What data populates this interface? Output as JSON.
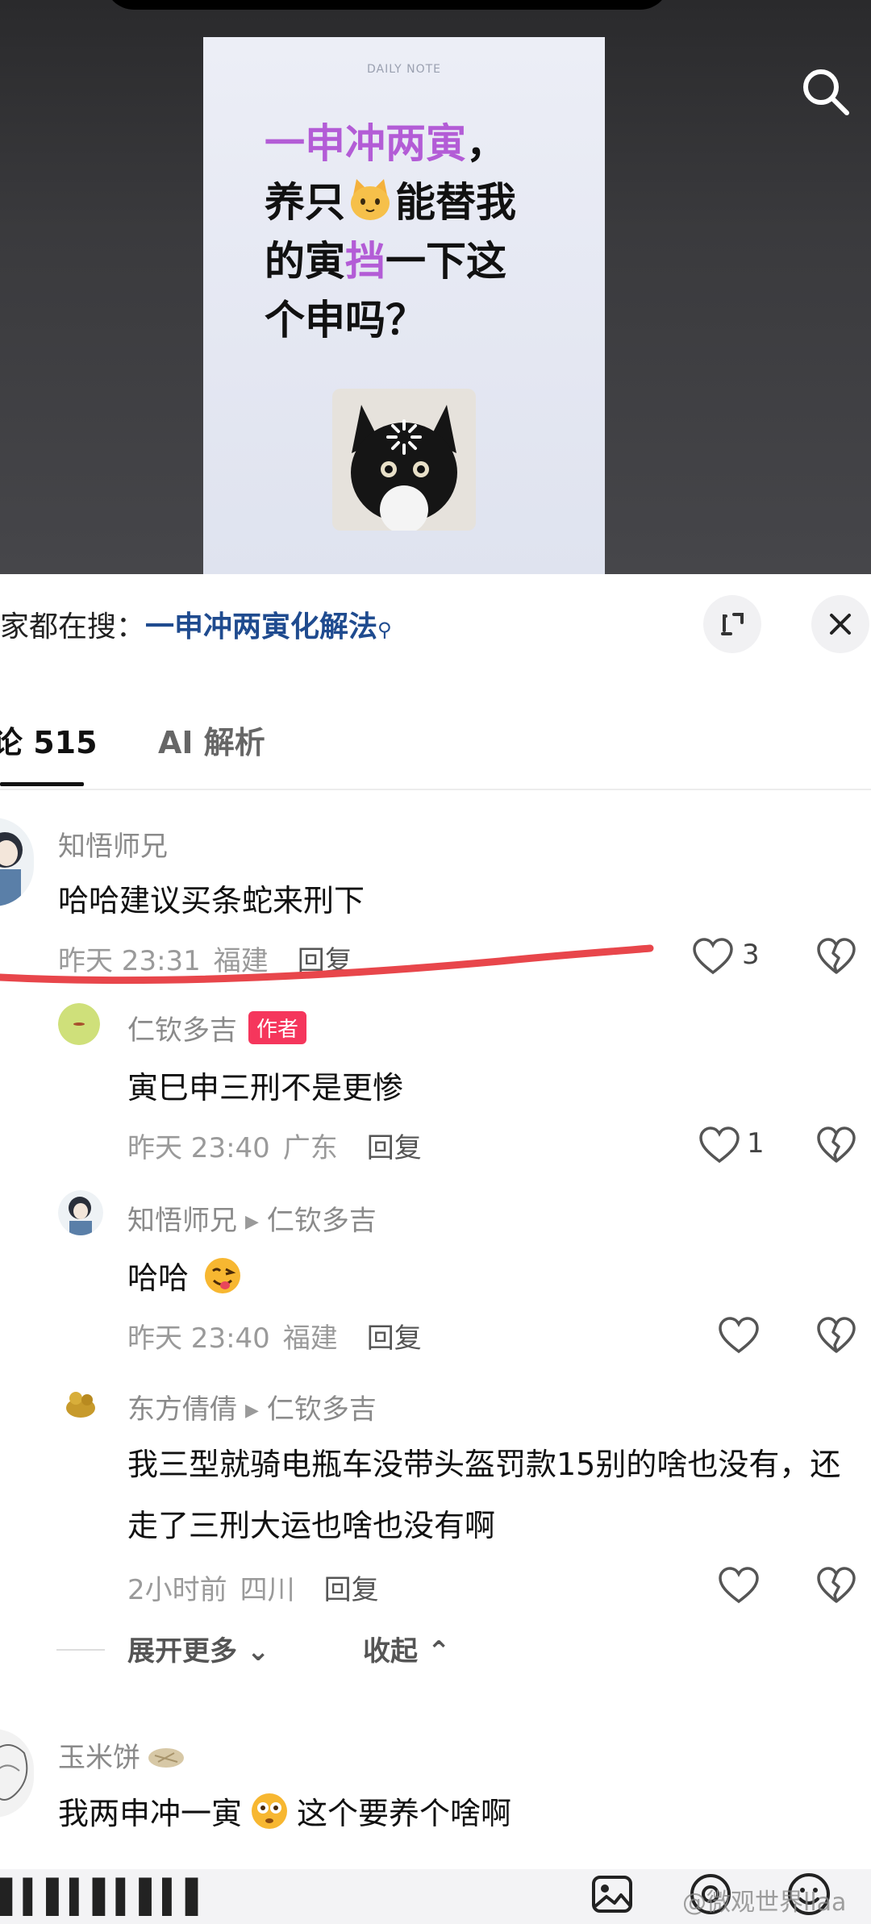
{
  "video": {
    "card_label": "DAILY NOTE",
    "line1_purple": "一申冲两寅",
    "line1_rest": "，",
    "line2_a": "养只",
    "line2_b": "能替我",
    "line3_a": "的寅",
    "line3_purple": "挡",
    "line3_b": "一下这",
    "line4": "个申吗？"
  },
  "search_suggestion": {
    "prefix": "家都在搜：",
    "link": "一申冲两寅化解法",
    "icon": "search-icon"
  },
  "tabs": {
    "comments": "论 515",
    "ai": "AI 解析"
  },
  "comments": [
    {
      "user": "知悟师兄",
      "text": "哈哈建议买条蛇来刑下",
      "time": "昨天 23:31",
      "location": "福建",
      "reply": "回复",
      "likes": "3"
    }
  ],
  "replies": [
    {
      "user": "仁钦多吉",
      "badge": "作者",
      "text": "寅巳申三刑不是更惨",
      "time": "昨天 23:40",
      "location": "广东",
      "reply": "回复",
      "likes": "1"
    },
    {
      "user": "知悟师兄",
      "reply_to": "仁钦多吉",
      "text": "哈哈",
      "time": "昨天 23:40",
      "location": "福建",
      "reply": "回复",
      "likes": ""
    },
    {
      "user": "东方倩倩",
      "reply_to": "仁钦多吉",
      "text": "我三型就骑电瓶车没带头盔罚款15别的啥也没有，还走了三刑大运也啥也没有啊",
      "time": "2小时前",
      "location": "四川",
      "reply": "回复",
      "likes": ""
    }
  ],
  "expand": {
    "more": "展开更多",
    "collapse": "收起"
  },
  "comment2": {
    "user": "玉米饼",
    "text_a": "我两申冲一寅",
    "text_b": "这个要养个啥啊"
  },
  "bottom": {
    "input_stub": "▌▍▌▍▌▍▌▍▌",
    "watermark": "@微观世界llaa"
  },
  "colors": {
    "accent_purple": "#b35cd6",
    "link_blue": "#1f4b8f",
    "author_badge": "#f5365c",
    "annotation_red": "#e8464b"
  }
}
